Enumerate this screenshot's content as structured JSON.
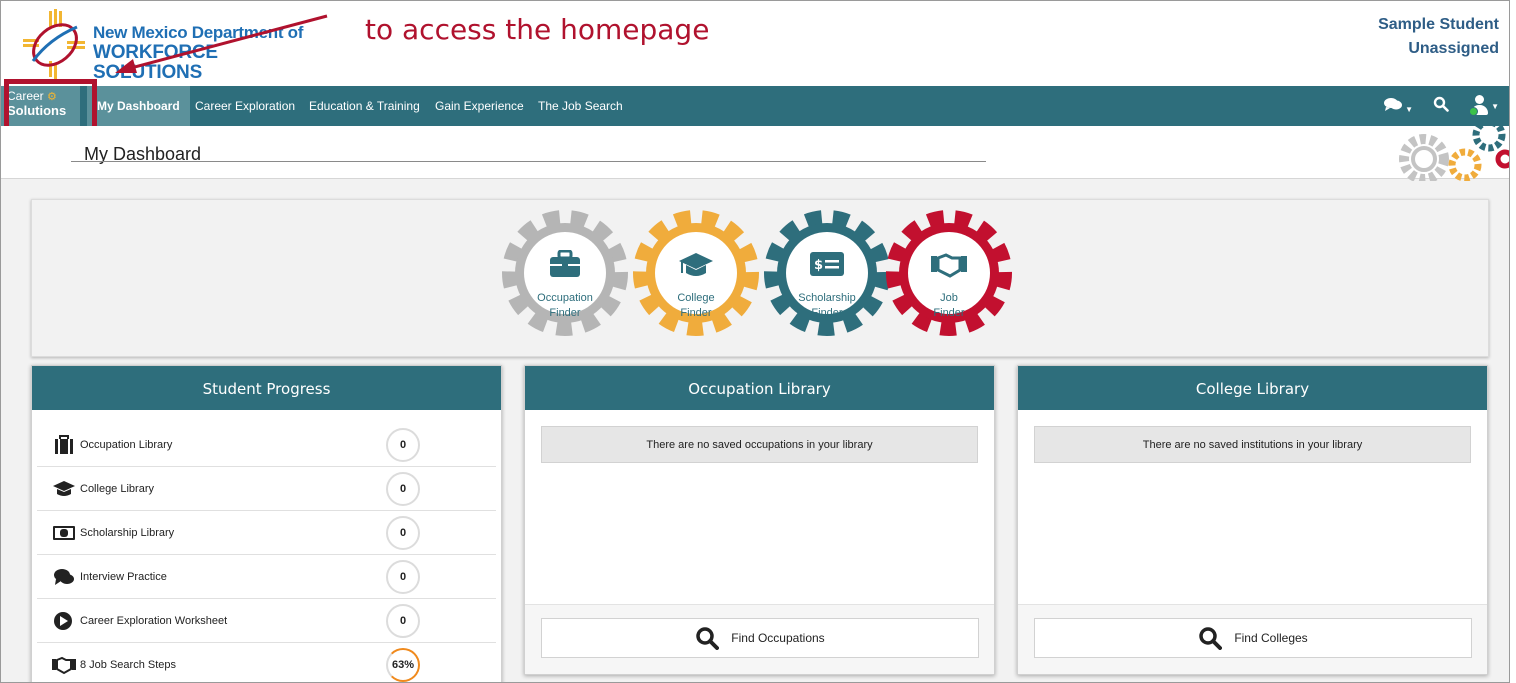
{
  "header": {
    "logo_line1": "New Mexico Department of",
    "logo_line2": "WORKFORCE SOLUTIONS",
    "annotation_text": "to access the homepage",
    "user_name": "Sample Student",
    "user_status": "Unassigned"
  },
  "nav": {
    "brand_line1": "Career",
    "brand_line2": "Solutions",
    "items": [
      {
        "label": "My Dashboard",
        "active": true
      },
      {
        "label": "Career Exploration"
      },
      {
        "label": "Education & Training"
      },
      {
        "label": "Gain Experience"
      },
      {
        "label": "The Job Search"
      }
    ],
    "icons": [
      "chat-icon",
      "search-icon",
      "user-icon"
    ]
  },
  "page": {
    "title": "My Dashboard"
  },
  "finders": [
    {
      "line1": "Occupation",
      "line2": "Finder",
      "color": "#b5b5b5",
      "icon": "briefcase-icon"
    },
    {
      "line1": "College",
      "line2": "Finder",
      "color": "#f0ac3c",
      "icon": "graduation-cap-icon"
    },
    {
      "line1": "Scholarship",
      "line2": "Finder",
      "color": "#2e6e7c",
      "icon": "money-icon"
    },
    {
      "line1": "Job",
      "line2": "Finder",
      "color": "#c2102f",
      "icon": "handshake-icon"
    }
  ],
  "progress": {
    "title": "Student Progress",
    "rows": [
      {
        "label": "Occupation Library",
        "value": "0",
        "icon": "briefcase-icon"
      },
      {
        "label": "College Library",
        "value": "0",
        "icon": "graduation-cap-icon"
      },
      {
        "label": "Scholarship Library",
        "value": "0",
        "icon": "money-icon"
      },
      {
        "label": "Interview Practice",
        "value": "0",
        "icon": "comments-icon"
      },
      {
        "label": "Career Exploration Worksheet",
        "value": "0",
        "icon": "play-circle-icon"
      },
      {
        "label": "8 Job Search Steps",
        "value": "63%",
        "icon": "handshake-icon"
      }
    ]
  },
  "occupation_library": {
    "title": "Occupation Library",
    "empty_text": "There are no saved occupations in your library",
    "button_label": "Find Occupations"
  },
  "college_library": {
    "title": "College Library",
    "empty_text": "There are no saved institutions in your library",
    "button_label": "Find Colleges"
  },
  "colors": {
    "teal": "#2e6e7c",
    "teal_light": "#5b919b",
    "annotation_red": "#b0122e",
    "orange": "#f08a1d"
  }
}
